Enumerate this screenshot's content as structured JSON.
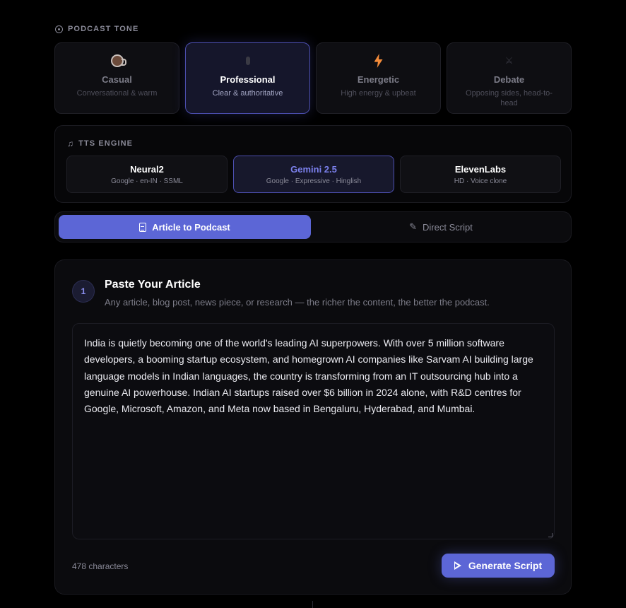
{
  "tone": {
    "label": "PODCAST TONE",
    "options": [
      {
        "name": "Casual",
        "desc": "Conversational & warm",
        "icon": "coffee-cup-icon",
        "active": false
      },
      {
        "name": "Professional",
        "desc": "Clear & authoritative",
        "icon": "microphone-icon",
        "active": true
      },
      {
        "name": "Energetic",
        "desc": "High energy & upbeat",
        "icon": "lightning-icon",
        "active": false
      },
      {
        "name": "Debate",
        "desc": "Opposing sides, head-to-head",
        "icon": "crossed-swords-icon",
        "active": false
      }
    ]
  },
  "tts": {
    "label": "TTS ENGINE",
    "options": [
      {
        "name": "Neural2",
        "sub": "Google · en-IN · SSML",
        "active": false
      },
      {
        "name": "Gemini 2.5",
        "sub": "Google · Expressive · Hinglish",
        "active": true
      },
      {
        "name": "ElevenLabs",
        "sub": "HD · Voice clone",
        "active": false
      }
    ]
  },
  "modes": {
    "article": "Article to Podcast",
    "script": "Direct Script"
  },
  "article": {
    "step": "1",
    "title": "Paste Your Article",
    "subtitle": "Any article, blog post, news piece, or research — the richer the content, the better the podcast.",
    "text": "India is quietly becoming one of the world's leading AI superpowers. With over 5 million software developers, a booming startup ecosystem, and homegrown AI companies like Sarvam AI building large language models in Indian languages, the country is transforming from an IT outsourcing hub into a genuine AI powerhouse. Indian AI startups raised over $6 billion in 2024 alone, with R&D centres for Google, Microsoft, Amazon, and Meta now based in Bengaluru, Hyderabad, and Mumbai.",
    "char_count": "478 characters",
    "generate_label": "Generate Script"
  },
  "colors": {
    "accent": "#5c66d6",
    "active_text": "#7b80ec",
    "energetic_icon": "#f38b3a"
  }
}
